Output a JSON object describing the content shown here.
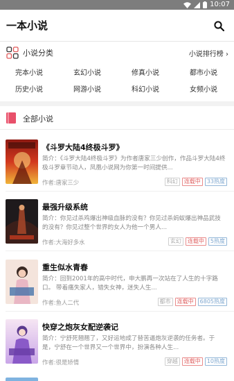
{
  "status_bar": {
    "time": "10:07"
  },
  "app_bar": {
    "title": "一本小说"
  },
  "category_section": {
    "title": "小说分类",
    "ranking_link": "小说排行榜",
    "categories": [
      "完本小说",
      "玄幻小说",
      "修真小说",
      "都市小说",
      "历史小说",
      "网游小说",
      "科幻小说",
      "女频小说"
    ]
  },
  "all_section": {
    "title": "全部小说"
  },
  "novels": [
    {
      "title": "《斗罗大陆4终极斗罗》",
      "intro": "简介：《斗罗大陆4终极斗罗》为作者唐家三少创作，作品斗罗大陆4终极斗罗章节动人，凤凰小说网为你第一时间提供...",
      "author": "作者:唐家三少",
      "category": "科幻",
      "status": "连载中",
      "heat": "33热度",
      "cover_colors": [
        "#c6271b",
        "#f2b63a"
      ]
    },
    {
      "title": "最强升级系统",
      "intro": "简介：你见过杀鸡爆出神级血脉的没有？你见过杀蚂蚁爆出神品武技的没有？你见过整个世界的女人为他一个男人...",
      "author": "作者:大海好多水",
      "category": "玄幻",
      "status": "连载中",
      "heat": "5热度",
      "cover_colors": [
        "#1e1a1c",
        "#7a3b2a"
      ]
    },
    {
      "title": "重生似水青春",
      "intro": "简介：回到2001年的高中时代，申大鹏再一次站在了人生的十字路口。 带着痛失家人，错失女神，迷失人生...",
      "author": "作者:鱼人二代",
      "category": "都市",
      "status": "连载中",
      "heat": "6805热度",
      "cover_colors": [
        "#f3d6c9",
        "#3b6ea8"
      ]
    },
    {
      "title": "快穿之炮灰女配逆袭记",
      "intro": "简介：宁舒死翘翘了，又好运地成了替苦逼炮灰逆袭的任务者。于是，宁舒在一个世界又一个世界中，扮演各种人生...",
      "author": "作者:很是矫情",
      "category": "穿越",
      "status": "连载中",
      "heat": "10热度",
      "cover_colors": [
        "#6a3ea8",
        "#f2c7e6"
      ]
    }
  ]
}
